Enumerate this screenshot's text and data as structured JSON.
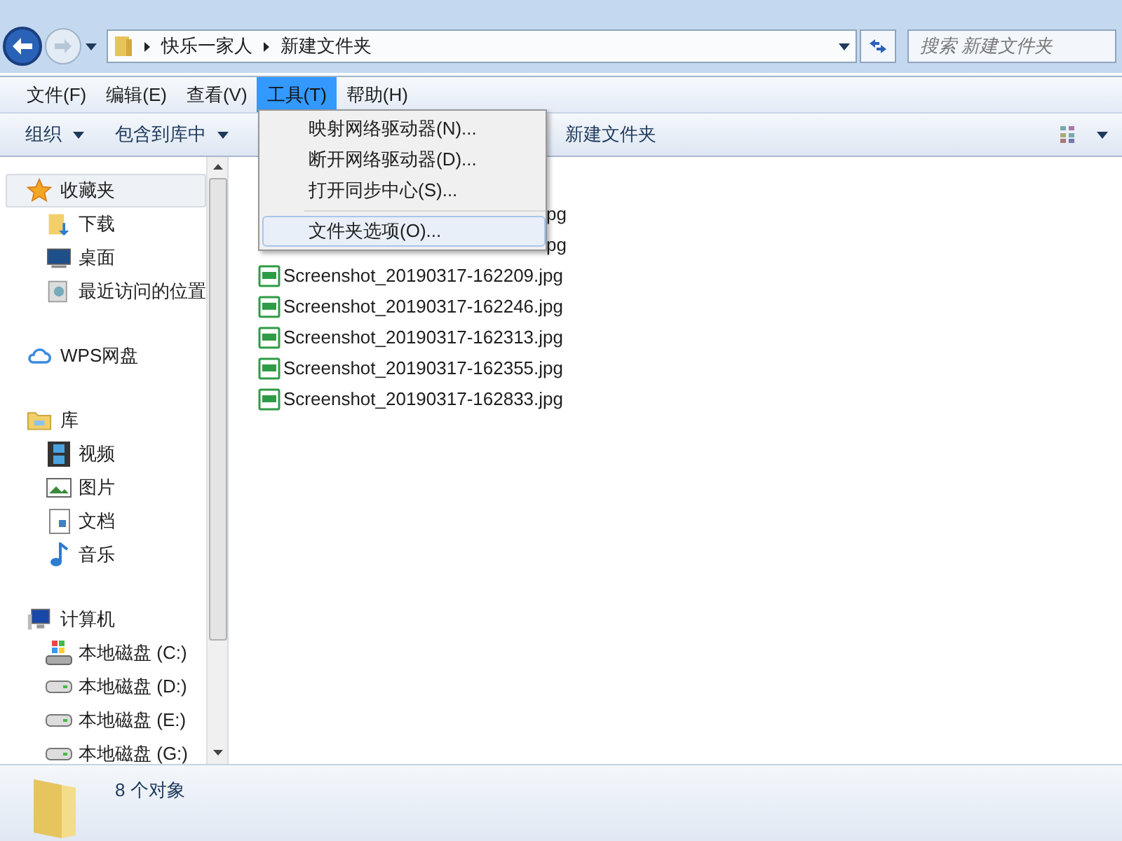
{
  "address_bar": {
    "path": [
      "快乐一家人",
      "新建文件夹"
    ]
  },
  "search": {
    "placeholder": "搜索 新建文件夹"
  },
  "menu_bar": [
    {
      "label": "文件(F)",
      "selected": false
    },
    {
      "label": "编辑(E)",
      "selected": false
    },
    {
      "label": "查看(V)",
      "selected": false
    },
    {
      "label": "工具(T)",
      "selected": true
    },
    {
      "label": "帮助(H)",
      "selected": false
    }
  ],
  "toolbar": [
    {
      "label": "组织",
      "kind": "dropdown"
    },
    {
      "label": "包含到库中",
      "kind": "dropdown"
    },
    {
      "label": "新建文件夹",
      "kind": "plain"
    }
  ],
  "dropdown_menu": {
    "sections": [
      [
        {
          "label": "映射网络驱动器(N)...",
          "selected": false
        },
        {
          "label": "断开网络驱动器(D)...",
          "selected": false
        },
        {
          "label": "打开同步中心(S)...",
          "selected": false
        }
      ],
      [
        {
          "label": "文件夹选项(O)...",
          "selected": true
        }
      ]
    ]
  },
  "navigation": [
    {
      "label": "收藏夹",
      "kind": "star",
      "selected": true,
      "children": [
        {
          "label": "下载",
          "kind": "download"
        },
        {
          "label": "桌面",
          "kind": "desktop"
        },
        {
          "label": "最近访问的位置",
          "kind": "recent"
        }
      ]
    },
    {
      "label": "WPS网盘",
      "kind": "cloud",
      "selected": false
    },
    {
      "label": "库",
      "kind": "library",
      "selected": false,
      "children": [
        {
          "label": "视频",
          "kind": "video"
        },
        {
          "label": "图片",
          "kind": "picture"
        },
        {
          "label": "文档",
          "kind": "document"
        },
        {
          "label": "音乐",
          "kind": "music"
        }
      ]
    },
    {
      "label": "计算机",
      "kind": "computer",
      "selected": false,
      "children": [
        {
          "label": "本地磁盘 (C:)",
          "kind": "system"
        },
        {
          "label": "本地磁盘 (D:)",
          "kind": "drive"
        },
        {
          "label": "本地磁盘 (E:)",
          "kind": "drive"
        },
        {
          "label": "本地磁盘 (G:)",
          "kind": "drive"
        }
      ]
    }
  ],
  "files": [
    {
      "name": "pg",
      "kind": "covered"
    },
    {
      "name": "pg",
      "kind": "covered"
    },
    {
      "name": "Screenshot_20190317-162209.jpg",
      "kind": "file"
    },
    {
      "name": "Screenshot_20190317-162246.jpg",
      "kind": "file"
    },
    {
      "name": "Screenshot_20190317-162313.jpg",
      "kind": "file"
    },
    {
      "name": "Screenshot_20190317-162355.jpg",
      "kind": "file"
    },
    {
      "name": "Screenshot_20190317-162833.jpg",
      "kind": "file"
    }
  ],
  "status_bar": {
    "count": "8 个对象"
  }
}
